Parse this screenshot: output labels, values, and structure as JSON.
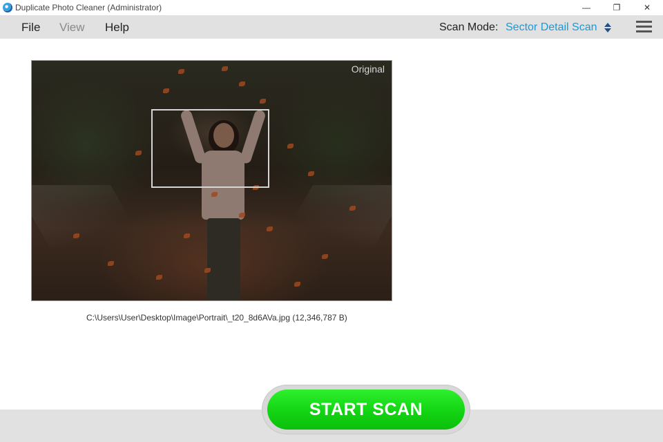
{
  "window": {
    "title": "Duplicate Photo Cleaner (Administrator)",
    "minimize_glyph": "—",
    "restore_glyph": "❐",
    "close_glyph": "✕"
  },
  "menu": {
    "items": [
      {
        "label": "File",
        "enabled": true
      },
      {
        "label": "View",
        "enabled": false
      },
      {
        "label": "Help",
        "enabled": true
      }
    ]
  },
  "scan_mode": {
    "label": "Scan Mode:",
    "value": "Sector Detail Scan"
  },
  "preview": {
    "badge": "Original",
    "file_path": "C:\\Users\\User\\Desktop\\Image\\Portrait\\_t20_8d6AVa.jpg (12,346,787 B)"
  },
  "actions": {
    "start_scan": "START SCAN"
  },
  "colors": {
    "accent": "#1a9ad6",
    "start_button": "#12d412",
    "menubar": "#e1e1e1"
  },
  "icons": {
    "app": "app-logo-icon",
    "scan_mode_toggle": "sort-arrows-icon",
    "menu": "hamburger-menu-icon"
  }
}
